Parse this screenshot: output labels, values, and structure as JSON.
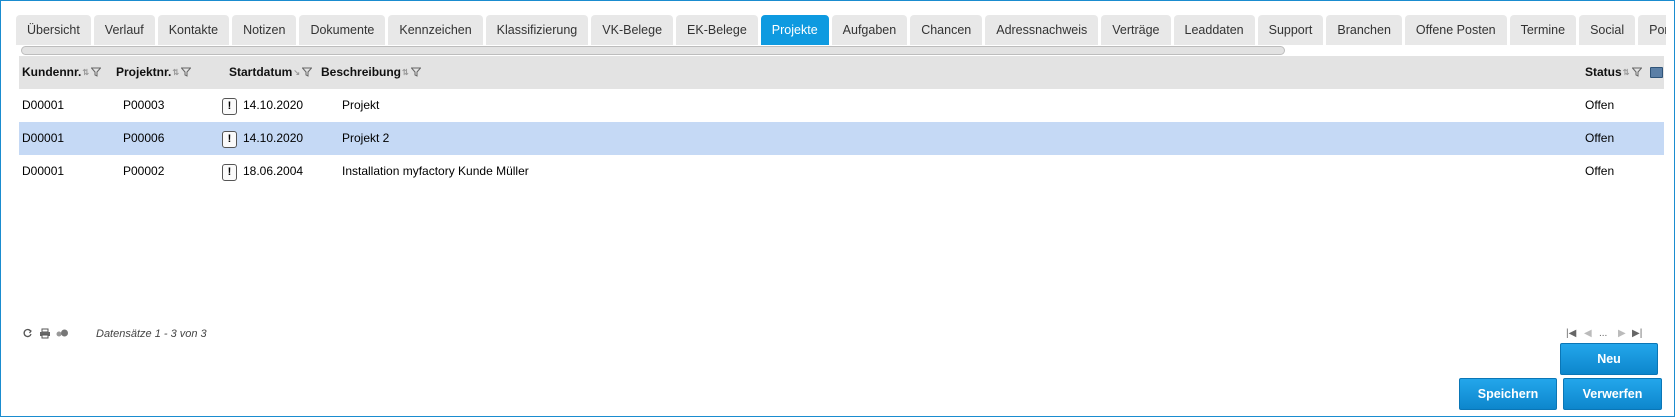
{
  "tabs": [
    {
      "label": "Übersicht"
    },
    {
      "label": "Verlauf"
    },
    {
      "label": "Kontakte"
    },
    {
      "label": "Notizen"
    },
    {
      "label": "Dokumente"
    },
    {
      "label": "Kennzeichen"
    },
    {
      "label": "Klassifizierung"
    },
    {
      "label": "VK-Belege"
    },
    {
      "label": "EK-Belege"
    },
    {
      "label": "Projekte",
      "active": true
    },
    {
      "label": "Aufgaben"
    },
    {
      "label": "Chancen"
    },
    {
      "label": "Adressnachweis"
    },
    {
      "label": "Verträge"
    },
    {
      "label": "Leaddaten"
    },
    {
      "label": "Support"
    },
    {
      "label": "Branchen"
    },
    {
      "label": "Offene Posten"
    },
    {
      "label": "Termine"
    },
    {
      "label": "Social"
    },
    {
      "label": "Portalbesuche"
    }
  ],
  "grid": {
    "columns": {
      "kundennr": "Kundennr.",
      "projektnr": "Projektnr.",
      "startdatum": "Startdatum",
      "beschreibung": "Beschreibung",
      "status": "Status"
    },
    "rows": [
      {
        "kundennr": "D00001",
        "projektnr": "P00003",
        "warn": "!",
        "startdatum": "14.10.2020",
        "beschreibung": "Projekt",
        "status": "Offen"
      },
      {
        "kundennr": "D00001",
        "projektnr": "P00006",
        "warn": "!",
        "startdatum": "14.10.2020",
        "beschreibung": "Projekt 2",
        "status": "Offen",
        "selected": true
      },
      {
        "kundennr": "D00001",
        "projektnr": "P00002",
        "warn": "!",
        "startdatum": "18.06.2004",
        "beschreibung": "Installation myfactory Kunde Müller",
        "status": "Offen"
      }
    ]
  },
  "footer": {
    "record_info": "Datensätze 1 - 3 von 3",
    "pager_ellipsis": "...",
    "icons": [
      "refresh-icon",
      "print-icon",
      "settings-icon"
    ]
  },
  "buttons": {
    "neu": "Neu",
    "speichern": "Speichern",
    "verwerfen": "Verwerfen"
  },
  "colors": {
    "accent": "#0e9ae0",
    "selected_row": "#c5d9f5",
    "header_bg": "#e3e3e3",
    "tab_bg": "#e8e8e8"
  }
}
